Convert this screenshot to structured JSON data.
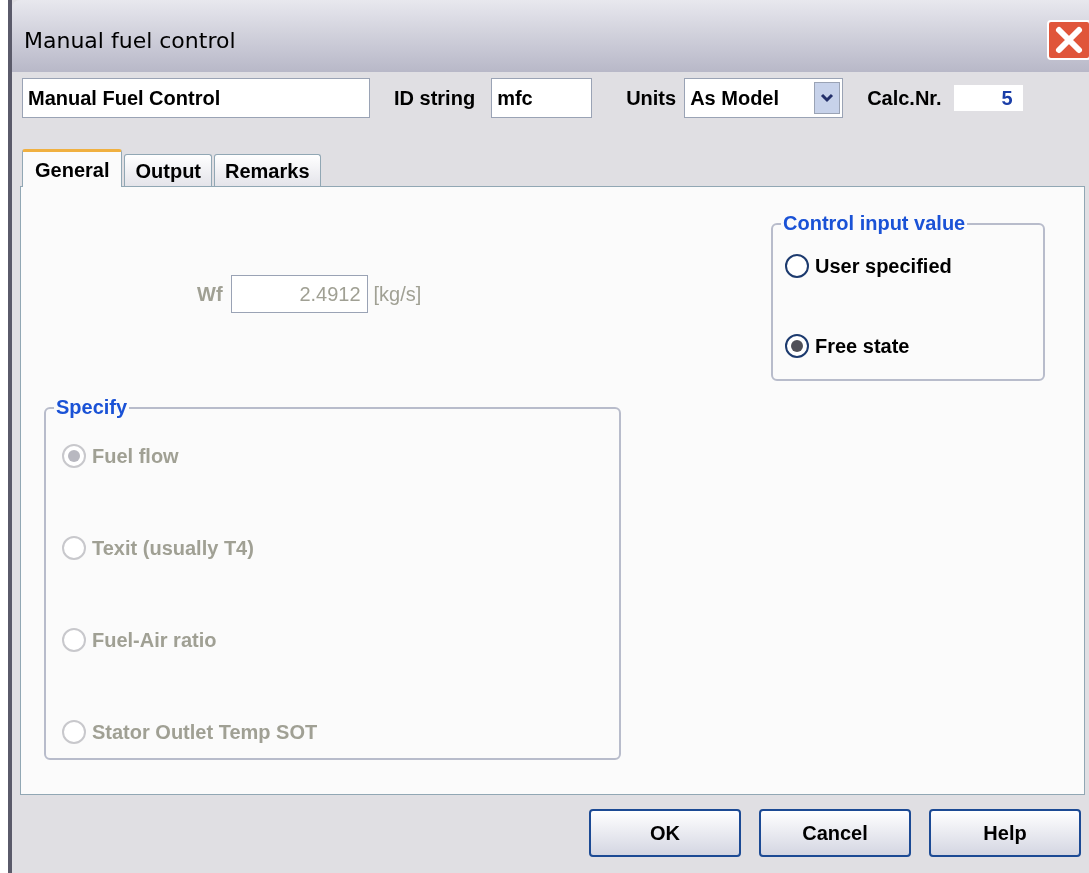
{
  "window": {
    "title": "Manual fuel control"
  },
  "header": {
    "name": "Manual Fuel Control",
    "id_label": "ID string",
    "id_value": "mfc",
    "units_label": "Units",
    "units_value": "As Model",
    "calc_label": "Calc.Nr.",
    "calc_value": "5"
  },
  "tabs": [
    {
      "label": "General",
      "selected": true
    },
    {
      "label": "Output",
      "selected": false
    },
    {
      "label": "Remarks",
      "selected": false
    }
  ],
  "general": {
    "wf": {
      "label": "Wf",
      "value": "2.4912",
      "unit": "[kg/s]",
      "disabled": true
    },
    "specify": {
      "title": "Specify",
      "disabled": true,
      "options": [
        {
          "label": "Fuel flow",
          "selected": true
        },
        {
          "label": "Texit (usually T4)",
          "selected": false
        },
        {
          "label": "Fuel-Air ratio",
          "selected": false
        },
        {
          "label": "Stator Outlet Temp SOT",
          "selected": false
        }
      ]
    },
    "control_input": {
      "title": "Control input value",
      "disabled": false,
      "options": [
        {
          "label": "User specified",
          "selected": false
        },
        {
          "label": "Free state",
          "selected": true
        }
      ]
    }
  },
  "buttons": [
    "OK",
    "Cancel",
    "Help"
  ]
}
